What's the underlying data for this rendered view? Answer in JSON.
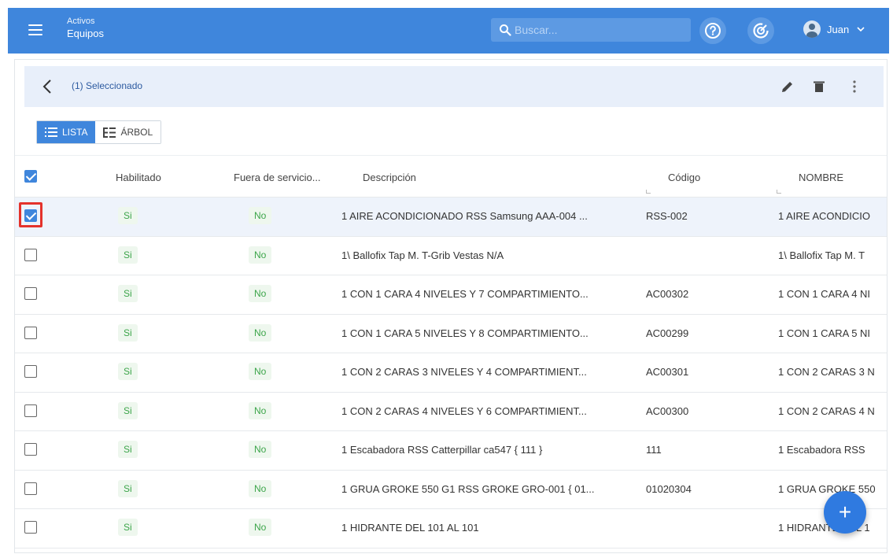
{
  "header": {
    "breadcrumb_parent": "Activos",
    "breadcrumb_current": "Equipos",
    "search_placeholder": "Buscar...",
    "user_name": "Juan"
  },
  "selection": {
    "count_label": "(1) Seleccionado"
  },
  "view_toggle": {
    "list_label": "LISTA",
    "tree_label": "ÁRBOL"
  },
  "table": {
    "columns": {
      "enabled": "Habilitado",
      "out_of_service": "Fuera de servicio...",
      "description": "Descripción",
      "code": "Código",
      "name": "NOMBRE"
    },
    "rows": [
      {
        "enabled": "Si",
        "out_of_service": "No",
        "description": "1 AIRE ACONDICIONADO RSS Samsung AAA-004 ...",
        "code": "RSS-002",
        "name": "1 AIRE ACONDICIO",
        "selected": true
      },
      {
        "enabled": "Si",
        "out_of_service": "No",
        "description": "1\\ Ballofix Tap M. T-Grib Vestas N/A",
        "code": "",
        "name": "1\\ Ballofix Tap M. T",
        "selected": false
      },
      {
        "enabled": "Si",
        "out_of_service": "No",
        "description": "1 CON 1 CARA 4 NIVELES Y 7 COMPARTIMIENTO...",
        "code": "AC00302",
        "name": "1 CON 1 CARA 4 NI",
        "selected": false
      },
      {
        "enabled": "Si",
        "out_of_service": "No",
        "description": "1 CON 1 CARA 5 NIVELES Y 8 COMPARTIMIENTO...",
        "code": "AC00299",
        "name": "1 CON 1 CARA 5 NI",
        "selected": false
      },
      {
        "enabled": "Si",
        "out_of_service": "No",
        "description": "1 CON 2 CARAS 3 NIVELES Y 4 COMPARTIMIENT...",
        "code": "AC00301",
        "name": "1 CON 2 CARAS 3 N",
        "selected": false
      },
      {
        "enabled": "Si",
        "out_of_service": "No",
        "description": "1 CON 2 CARAS 4 NIVELES Y 6 COMPARTIMIENT...",
        "code": "AC00300",
        "name": "1 CON 2 CARAS 4 N",
        "selected": false
      },
      {
        "enabled": "Si",
        "out_of_service": "No",
        "description": "1 Escabadora RSS Catterpillar ca547 { 111 }",
        "code": "111",
        "name": "1 Escabadora RSS",
        "selected": false
      },
      {
        "enabled": "Si",
        "out_of_service": "No",
        "description": "1 GRUA GROKE 550 G1 RSS GROKE GRO-001 { 01...",
        "code": "01020304",
        "name": "1 GRUA GROKE 550",
        "selected": false
      },
      {
        "enabled": "Si",
        "out_of_service": "No",
        "description": "1 HIDRANTE DEL 101 AL 101",
        "code": "",
        "name": "1 HIDRANTE DEL 1",
        "selected": false
      }
    ]
  },
  "fab": {
    "label": "+"
  },
  "colors": {
    "primary": "#3f86dc",
    "selection_bar": "#e8effa",
    "highlight_box": "#e4322b",
    "badge_text": "#3ca54a"
  }
}
